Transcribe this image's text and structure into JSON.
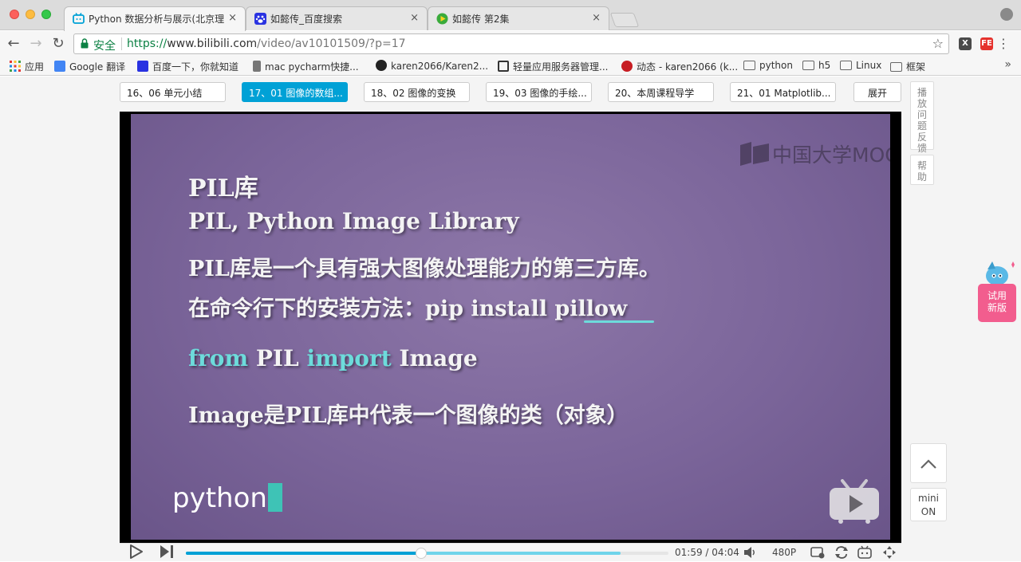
{
  "browser": {
    "tabs": [
      {
        "title": "Python 数据分析与展示(北京理",
        "favicon_color": "#00a1d6",
        "active": true
      },
      {
        "title": "如懿传_百度搜索",
        "favicon_color": "#2932e1",
        "active": false
      },
      {
        "title": "如懿传 第2集",
        "favicon_color": "#3aab3b",
        "active": false
      }
    ],
    "close_glyph": "×",
    "address": {
      "secure_label": "安全",
      "scheme": "https://",
      "host": "www.bilibili.com",
      "path": "/video/av10101509/?p=17"
    },
    "bookmarks": [
      {
        "label": "应用",
        "icon": "apps-icon"
      },
      {
        "label": "Google 翻译",
        "icon": "google-translate-icon"
      },
      {
        "label": "百度一下，你就知道",
        "icon": "baidu-icon"
      },
      {
        "label": "mac pycharm快捷...",
        "icon": "pycharm-icon"
      },
      {
        "label": "karen2066/Karen2...",
        "icon": "github-icon"
      },
      {
        "label": "轻量应用服务器管理...",
        "icon": "cloud-icon"
      },
      {
        "label": "动态 - karen2066 (k...",
        "icon": "gitee-icon"
      },
      {
        "label": "python",
        "icon": "folder-icon"
      },
      {
        "label": "h5",
        "icon": "folder-icon"
      },
      {
        "label": "Linux",
        "icon": "folder-icon"
      },
      {
        "label": "框架",
        "icon": "folder-icon"
      }
    ],
    "bookmarks_more": "»"
  },
  "episodes": [
    {
      "label": "16、06 单元小结",
      "active": false
    },
    {
      "label": "17、01 图像的数组...",
      "active": true
    },
    {
      "label": "18、02 图像的变换",
      "active": false
    },
    {
      "label": "19、03 图像的手绘...",
      "active": false
    },
    {
      "label": "20、本周课程导学",
      "active": false
    },
    {
      "label": "21、01 Matplotlib...",
      "active": false
    }
  ],
  "expand_label": "展开",
  "side": {
    "feedback": "播放问题反馈",
    "help": "帮助"
  },
  "slide": {
    "heading": "PIL库",
    "subheading": "PIL, Python Image Library",
    "line1": "PIL库是一个具有强大图像处理能力的第三方库。",
    "line2_prefix": "在命令行下的安装方法：pip install ",
    "line2_pillow": "pillow",
    "code_from": "from",
    "code_pil": " PIL ",
    "code_import": "import",
    "code_image": " Image",
    "line4": "Image是PIL库中代表一个图像的类（对象）",
    "watermark": "中国大学MOOC",
    "python_logo": "python"
  },
  "player": {
    "current_time": "01:59",
    "time_sep": "/",
    "total_time": "04:04",
    "quality": "480P",
    "progress_played": 0.487,
    "progress_buffered": 0.9
  },
  "floating": {
    "mini_label": "mini",
    "mini_state": "ON",
    "try_new_line1": "试用",
    "try_new_line2": "新版"
  }
}
